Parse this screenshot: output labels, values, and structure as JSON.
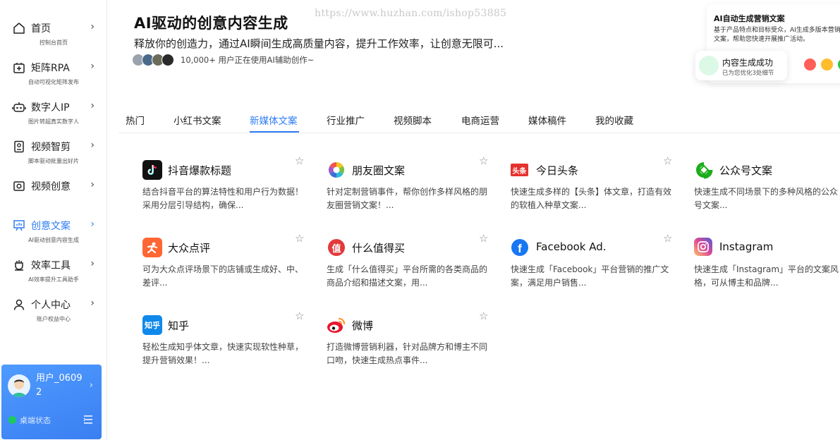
{
  "sidebar": {
    "items": [
      {
        "label": "首页",
        "sub": "控制台首页",
        "icon": "home-icon"
      },
      {
        "label": "矩阵RPA",
        "sub": "自动可视化矩阵发布",
        "icon": "rpa-icon"
      },
      {
        "label": "数字人IP",
        "sub": "图片转超真实数字人",
        "icon": "robot-icon"
      },
      {
        "label": "视频智剪",
        "sub": "脚本驱动批量出好片",
        "icon": "video-edit-icon"
      },
      {
        "label": "视频创意",
        "sub": "",
        "icon": "camera-icon"
      },
      {
        "label": "创意文案",
        "sub": "AI驱动创意内容生成",
        "icon": "chart-board-icon",
        "active": true
      },
      {
        "label": "效率工具",
        "sub": "AI效率提升工具助手",
        "icon": "tool-icon"
      },
      {
        "label": "个人中心",
        "sub": "账户权益中心",
        "icon": "user-icon"
      }
    ],
    "chevron": "›",
    "user": {
      "name": "用户_06092",
      "status": "桌端状态"
    }
  },
  "header": {
    "title": "AI驱动的创意内容生成",
    "subtitle": "释放你的创造力，通过AI瞬间生成高质量内容，提升工作效率，让创意无限可...",
    "users_count": "10,000+ 用户正在使用AI辅助创作~",
    "watermark": "https://www.huzhan.com/ishop53885"
  },
  "float_card": {
    "title": "AI自动生成营销文案",
    "body": "基于产品特点和目标受众，AI生成多版本营销文案，帮助您快速开展推广活动。",
    "dot_colors": [
      "#ff5f57",
      "#ffbd2e",
      "#28c840"
    ]
  },
  "toast": {
    "title": "内容生成成功",
    "sub": "已为您优化3处细节"
  },
  "tabs": [
    {
      "label": "热门"
    },
    {
      "label": "小红书文案"
    },
    {
      "label": "新媒体文案",
      "active": true
    },
    {
      "label": "行业推广"
    },
    {
      "label": "视频脚本"
    },
    {
      "label": "电商运营"
    },
    {
      "label": "媒体稿件"
    },
    {
      "label": "我的收藏"
    }
  ],
  "cards": [
    {
      "title": "抖音爆款标题",
      "desc": "结合抖音平台的算法特性和用户行为数据！采用分层引导结构，确保...",
      "icon": "douyin-icon"
    },
    {
      "title": "朋友圈文案",
      "desc": "针对定制营销事件，帮你创作多样风格的朋友圈营销文案！...",
      "icon": "moments-icon"
    },
    {
      "title": "今日头条",
      "desc": "快速生成多样的【头条】体文章，打造有效的软植入种草文案...",
      "icon": "toutiao-icon",
      "icon_text": "头条"
    },
    {
      "title": "公众号文案",
      "desc": "快速生成不同场景下的多种风格的公众号文案...",
      "icon": "wechat-official-icon"
    },
    {
      "title": "大众点评",
      "desc": "可为大众点评场景下的店铺或生成好、中、差评...",
      "icon": "dianping-icon"
    },
    {
      "title": "什么值得买",
      "desc": "生成「什么值得买」平台所需的各类商品的商品介绍和描述文案，用...",
      "icon": "smzdm-icon",
      "icon_text": "值"
    },
    {
      "title": "Facebook Ad.",
      "desc": "快速生成「Facebook」平台营销的推广文案，满足用户销售...",
      "icon": "facebook-icon",
      "icon_text": "f"
    },
    {
      "title": "Instagram",
      "desc": "快速生成「Instagram」平台的文案风格，可从博主和品牌...",
      "icon": "instagram-icon"
    },
    {
      "title": "知乎",
      "desc": "轻松生成知乎体文章，快速实现软性种草，提升营销效果！...",
      "icon": "zhihu-icon",
      "icon_text": "知乎"
    },
    {
      "title": "微博",
      "desc": "打造微博营销利器，针对品牌方和博主不同口吻，快速生成热点事件...",
      "icon": "weibo-icon"
    }
  ],
  "star": "☆"
}
